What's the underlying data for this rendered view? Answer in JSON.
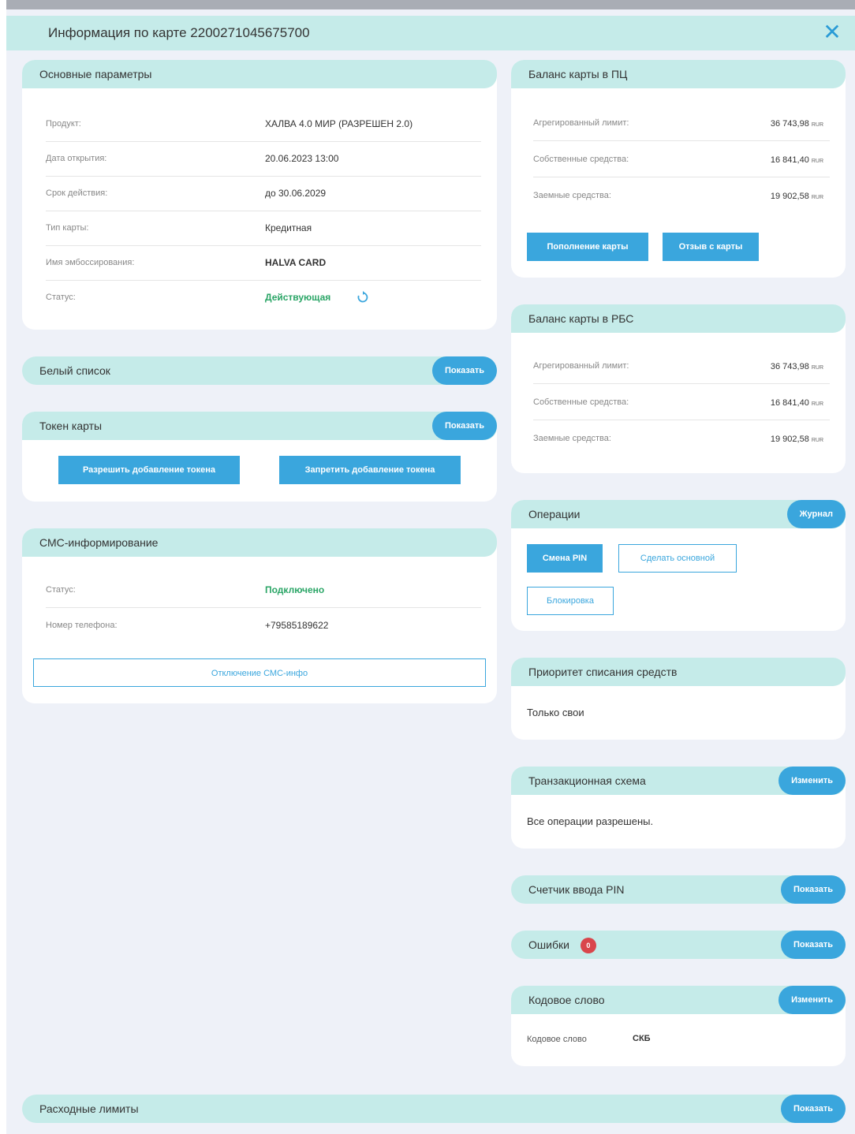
{
  "window": {
    "title": "Информация по карте 2200271045675700"
  },
  "main_params": {
    "title": "Основные параметры",
    "rows": [
      {
        "label": "Продукт:",
        "value": "ХАЛВА 4.0 МИР (РАЗРЕШЕН 2.0)"
      },
      {
        "label": "Дата открытия:",
        "value": "20.06.2023 13:00"
      },
      {
        "label": "Срок действия:",
        "value": "до 30.06.2029"
      },
      {
        "label": "Тип карты:",
        "value": "Кредитная"
      },
      {
        "label": "Имя эмбоссирования:",
        "value": "HALVA CARD"
      },
      {
        "label": "Статус:",
        "value": "Действующая"
      }
    ]
  },
  "whitelist": {
    "title": "Белый список",
    "button": "Показать"
  },
  "token": {
    "title": "Токен карты",
    "button": "Показать",
    "allow": "Разрешить добавление токена",
    "deny": "Запретить добавление токена"
  },
  "sms": {
    "title": "СМС-информирование",
    "rows": [
      {
        "label": "Статус:",
        "value": "Подключено"
      },
      {
        "label": "Номер телефона:",
        "value": "+79585189622"
      }
    ],
    "disable_button": "Отключение СМС-инфо"
  },
  "balance_pc": {
    "title": "Баланс карты в ПЦ",
    "rows": [
      {
        "label": "Агрегированный лимит:",
        "amount": "36 743,98",
        "currency": "RUR"
      },
      {
        "label": "Собственные средства:",
        "amount": "16 841,40",
        "currency": "RUR"
      },
      {
        "label": "Заемные средства:",
        "amount": "19 902,58",
        "currency": "RUR"
      }
    ],
    "topup": "Пополнение карты",
    "withdraw": "Отзыв с карты"
  },
  "balance_rbs": {
    "title": "Баланс карты в РБС",
    "rows": [
      {
        "label": "Агрегированный лимит:",
        "amount": "36 743,98",
        "currency": "RUR"
      },
      {
        "label": "Собственные средства:",
        "amount": "16 841,40",
        "currency": "RUR"
      },
      {
        "label": "Заемные средства:",
        "amount": "19 902,58",
        "currency": "RUR"
      }
    ]
  },
  "operations": {
    "title": "Операции",
    "journal": "Журнал",
    "change_pin": "Смена PIN",
    "make_main": "Сделать основной",
    "block": "Блокировка"
  },
  "priority": {
    "title": "Приоритет списания средств",
    "text": "Только свои"
  },
  "tx_scheme": {
    "title": "Транзакционная схема",
    "button": "Изменить",
    "text": "Все операции разрешены."
  },
  "pin_counter": {
    "title": "Счетчик ввода PIN",
    "button": "Показать"
  },
  "errors": {
    "title": "Ошибки",
    "count": "0",
    "button": "Показать"
  },
  "code_word": {
    "title": "Кодовое слово",
    "button": "Изменить",
    "label": "Кодовое слово",
    "value": "СКБ"
  },
  "limits": {
    "title": "Расходные лимиты",
    "button": "Показать"
  },
  "colors": {
    "accent": "#3aa6dd",
    "header_bg": "#c5ebe9",
    "status_green": "#2aa566",
    "badge_red": "#d9464c"
  }
}
